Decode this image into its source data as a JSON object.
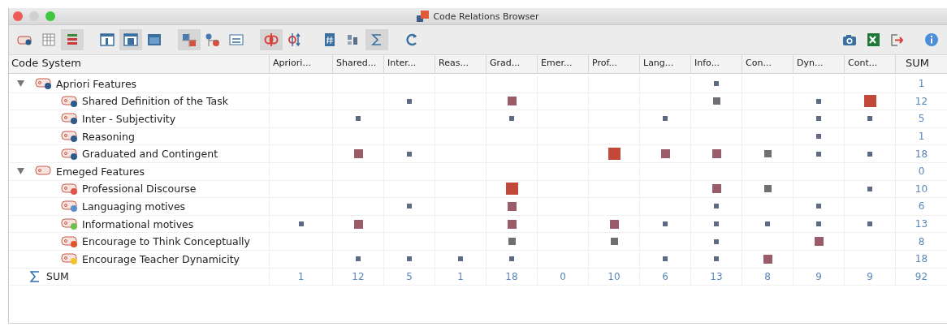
{
  "window": {
    "title": "Code Relations Browser"
  },
  "toolbar": {
    "left": [
      {
        "kind": "code-tag",
        "on": false
      },
      {
        "kind": "grid",
        "on": false
      },
      {
        "kind": "stripes",
        "on": true
      },
      {
        "kind": "pane-left",
        "on": false
      },
      {
        "kind": "pane-center",
        "on": true
      },
      {
        "kind": "pane-full",
        "on": false
      },
      {
        "kind": "squares",
        "on": true
      },
      {
        "kind": "nodes",
        "on": false
      },
      {
        "kind": "counter",
        "on": false
      },
      {
        "kind": "intersect",
        "on": true
      },
      {
        "kind": "sort",
        "on": false
      },
      {
        "kind": "hash",
        "on": false
      },
      {
        "kind": "bars",
        "on": false
      },
      {
        "kind": "sigma",
        "on": true
      },
      {
        "kind": "refresh",
        "on": false
      }
    ],
    "right": [
      {
        "kind": "camera"
      },
      {
        "kind": "excel"
      },
      {
        "kind": "export"
      },
      {
        "kind": "info"
      }
    ]
  },
  "table": {
    "first_column": "Code System",
    "columns": [
      "Apriori...",
      "Shared...",
      "Inter...",
      "Reas...",
      "Grad...",
      "Emer...",
      "Prof...",
      "Lang...",
      "Info...",
      "Con...",
      "Dyn...",
      "Cont..."
    ],
    "sum_column": "SUM",
    "tree": [
      {
        "label": "Apriori  Features",
        "color": "#2e5a8a",
        "expanded": true,
        "sum": "1",
        "cells": [
          null,
          null,
          null,
          null,
          null,
          null,
          null,
          null,
          {
            "kind": "small"
          },
          null,
          null,
          null
        ],
        "children": [
          {
            "label": "Shared Definition of the Task",
            "color": "#2e5a8a",
            "sum": "12",
            "cells": [
              null,
              null,
              {
                "kind": "small"
              },
              null,
              {
                "kind": "medium"
              },
              null,
              null,
              null,
              {
                "kind": "grey"
              },
              null,
              {
                "kind": "small"
              },
              {
                "kind": "large"
              }
            ]
          },
          {
            "label": "Inter - Subjectivity",
            "color": "#2e5a8a",
            "sum": "5",
            "cells": [
              null,
              {
                "kind": "small"
              },
              null,
              null,
              {
                "kind": "small"
              },
              null,
              null,
              {
                "kind": "small"
              },
              null,
              null,
              {
                "kind": "small"
              },
              {
                "kind": "small"
              }
            ]
          },
          {
            "label": "Reasoning",
            "color": "#2e5a8a",
            "sum": "1",
            "cells": [
              null,
              null,
              null,
              null,
              null,
              null,
              null,
              null,
              null,
              null,
              {
                "kind": "small"
              },
              null
            ]
          },
          {
            "label": "Graduated and Contingent",
            "color": "#2e5a8a",
            "sum": "18",
            "cells": [
              null,
              {
                "kind": "medium"
              },
              {
                "kind": "small"
              },
              null,
              null,
              null,
              {
                "kind": "large"
              },
              {
                "kind": "medium"
              },
              {
                "kind": "medium"
              },
              {
                "kind": "grey"
              },
              {
                "kind": "small"
              },
              {
                "kind": "small"
              }
            ]
          }
        ]
      },
      {
        "label": "Emeged Features",
        "expanded": true,
        "sum": "0",
        "cells": [
          null,
          null,
          null,
          null,
          null,
          null,
          null,
          null,
          null,
          null,
          null,
          null
        ],
        "children": [
          {
            "label": "Professional Discourse",
            "color": "#e0524a",
            "sum": "10",
            "cells": [
              null,
              null,
              null,
              null,
              {
                "kind": "large"
              },
              null,
              null,
              null,
              {
                "kind": "medium"
              },
              {
                "kind": "grey"
              },
              null,
              {
                "kind": "small"
              }
            ]
          },
          {
            "label": "Languaging motives",
            "color": "#5b8fc7",
            "sum": "6",
            "cells": [
              null,
              null,
              {
                "kind": "small"
              },
              null,
              {
                "kind": "medium"
              },
              null,
              null,
              null,
              {
                "kind": "small"
              },
              null,
              {
                "kind": "small"
              },
              null
            ]
          },
          {
            "label": "Informational motives",
            "color": "#6fbf4a",
            "sum": "13",
            "cells": [
              {
                "kind": "small"
              },
              {
                "kind": "medium"
              },
              null,
              null,
              {
                "kind": "medium"
              },
              null,
              {
                "kind": "medium"
              },
              {
                "kind": "small"
              },
              {
                "kind": "small"
              },
              {
                "kind": "small"
              },
              {
                "kind": "small"
              },
              {
                "kind": "small"
              }
            ]
          },
          {
            "label": "Encourage to Think Conceptually",
            "color": "#e0522a",
            "sum": "8",
            "cells": [
              null,
              null,
              null,
              null,
              {
                "kind": "grey"
              },
              null,
              {
                "kind": "grey"
              },
              null,
              {
                "kind": "small"
              },
              null,
              {
                "kind": "medium"
              },
              null
            ]
          },
          {
            "label": "Encourage Teacher Dynamicity",
            "color": "#f2c230",
            "sum": "18",
            "cells": [
              null,
              {
                "kind": "small"
              },
              {
                "kind": "small"
              },
              {
                "kind": "small"
              },
              {
                "kind": "small"
              },
              null,
              null,
              {
                "kind": "small"
              },
              {
                "kind": "small"
              },
              {
                "kind": "medium"
              },
              null,
              null
            ]
          }
        ]
      }
    ],
    "sum_row": {
      "label": "SUM",
      "values": [
        "1",
        "12",
        "5",
        "1",
        "18",
        "0",
        "10",
        "6",
        "13",
        "8",
        "9",
        "9",
        "92"
      ]
    }
  }
}
